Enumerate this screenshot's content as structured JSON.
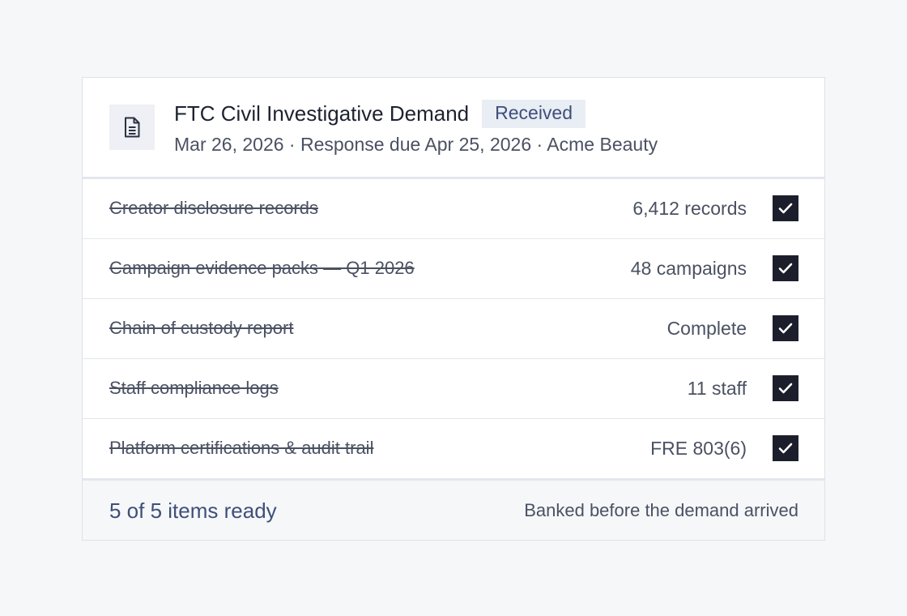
{
  "demand": {
    "title": "FTC Civil Investigative Demand",
    "status": "Received",
    "subtitle": "Mar 26, 2026 · Response due Apr 25, 2026 · Acme Beauty",
    "icon": "document-icon"
  },
  "items": [
    {
      "label": "Creator disclosure records",
      "value": "6,412 records",
      "checked": true
    },
    {
      "label": "Campaign evidence packs — Q1 2026",
      "value": "48 campaigns",
      "checked": true
    },
    {
      "label": "Chain of custody report",
      "value": "Complete",
      "checked": true
    },
    {
      "label": "Staff compliance logs",
      "value": "11 staff",
      "checked": true
    },
    {
      "label": "Platform certifications & audit trail",
      "value": "FRE 803(6)",
      "checked": true
    }
  ],
  "footer": {
    "summary": "5 of 5 items ready",
    "note": "Banked before the demand arrived"
  },
  "colors": {
    "accent": "#3e4f7a",
    "check_fill": "#1c1f2b",
    "badge_bg": "#e9edf4"
  }
}
